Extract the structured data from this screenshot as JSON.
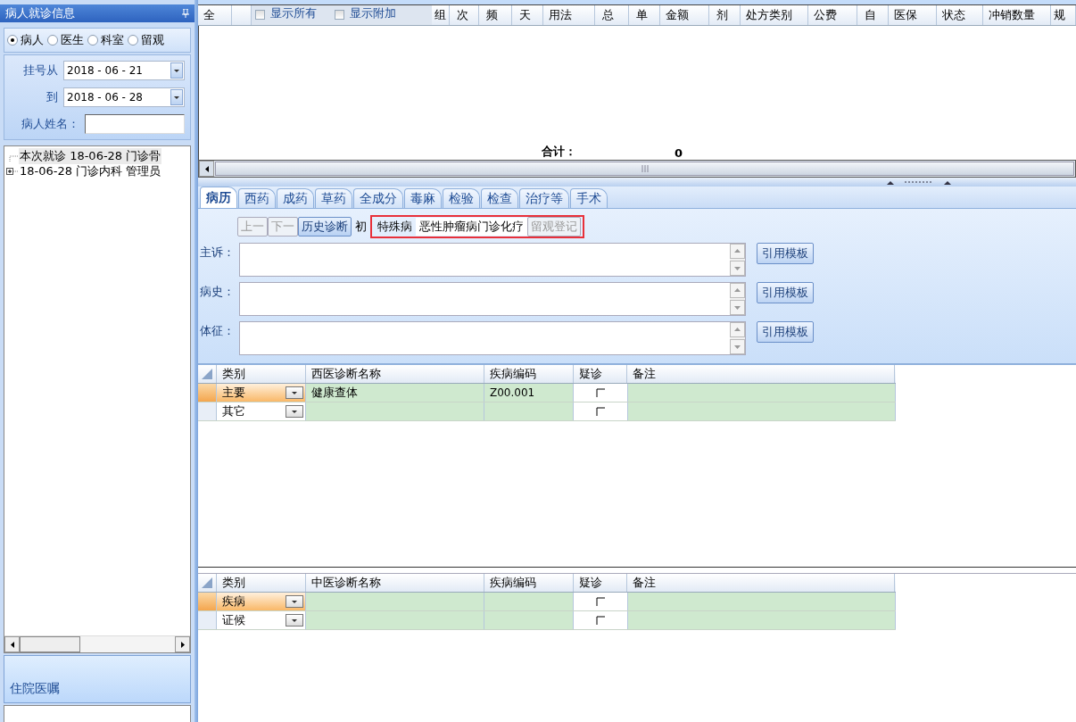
{
  "left_panel": {
    "title": "病人就诊信息",
    "query_modes": [
      {
        "label": "病人",
        "selected": true
      },
      {
        "label": "医生",
        "selected": false
      },
      {
        "label": "科室",
        "selected": false
      },
      {
        "label": "留观",
        "selected": false
      }
    ],
    "date_from": {
      "label": "挂号从",
      "value": "2018 - 06 - 21"
    },
    "date_to": {
      "label": "到",
      "value": "2018 - 06 - 28"
    },
    "patient_name": {
      "label": "病人姓名："
    },
    "visit_tree": [
      {
        "label": "本次就诊 18-06-28 门诊骨",
        "selected": true,
        "expandable": false
      },
      {
        "label": "18-06-28 门诊内科 管理员",
        "selected": false,
        "expandable": true
      }
    ],
    "inpatient_orders": {
      "title": "住院医嘱"
    }
  },
  "prescription_grid": {
    "columns": [
      "全",
      "",
      "组",
      "次",
      "频",
      "天",
      "用法",
      "总",
      "单",
      "金额",
      "剂",
      "处方类别",
      "公费",
      "自",
      "医保",
      "状态",
      "冲销数量",
      "规"
    ],
    "options": [
      {
        "label": "显示所有",
        "checked": false
      },
      {
        "label": "显示附加",
        "checked": false
      }
    ],
    "total": {
      "label": "合计：",
      "value": "0"
    }
  },
  "tabs": [
    {
      "label": "病历",
      "selected": true
    },
    {
      "label": "西药",
      "selected": false
    },
    {
      "label": "成药",
      "selected": false
    },
    {
      "label": "草药",
      "selected": false
    },
    {
      "label": "全成分",
      "selected": false
    },
    {
      "label": "毒麻",
      "selected": false
    },
    {
      "label": "检验",
      "selected": false
    },
    {
      "label": "检查",
      "selected": false
    },
    {
      "label": "治疗等",
      "selected": false
    },
    {
      "label": "手术",
      "selected": false
    }
  ],
  "record_toolbar": {
    "buttons": [
      {
        "label": "上一",
        "disabled": true
      },
      {
        "label": "下一",
        "disabled": true
      },
      {
        "label": "历史诊断",
        "disabled": false
      }
    ],
    "first_visit_label": "初",
    "highlighted": true,
    "special_disease": {
      "label": "特殊病",
      "value": "恶性肿瘤病门诊化疗"
    },
    "observation_button": {
      "label": "留观登记",
      "disabled": true
    }
  },
  "record_fields": [
    {
      "label": "主诉：",
      "button": "引用模板"
    },
    {
      "label": "病史：",
      "button": "引用模板"
    },
    {
      "label": "体征：",
      "button": "引用模板"
    }
  ],
  "western_diagnoses": {
    "columns": [
      "类别",
      "西医诊断名称",
      "疾病编码",
      "疑诊",
      "备注"
    ],
    "rows": [
      {
        "category": "主要",
        "name": "健康查体",
        "code": "Z00.001",
        "suspected": false,
        "selected": true
      },
      {
        "category": "其它",
        "suspected": false,
        "selected": false
      }
    ]
  },
  "tcm_diagnoses": {
    "columns": [
      "类别",
      "中医诊断名称",
      "疾病编码",
      "疑诊",
      "备注"
    ],
    "rows": [
      {
        "category": "疾病",
        "suspected": false,
        "selected": true
      },
      {
        "category": "证候",
        "suspected": false,
        "selected": false
      }
    ]
  }
}
